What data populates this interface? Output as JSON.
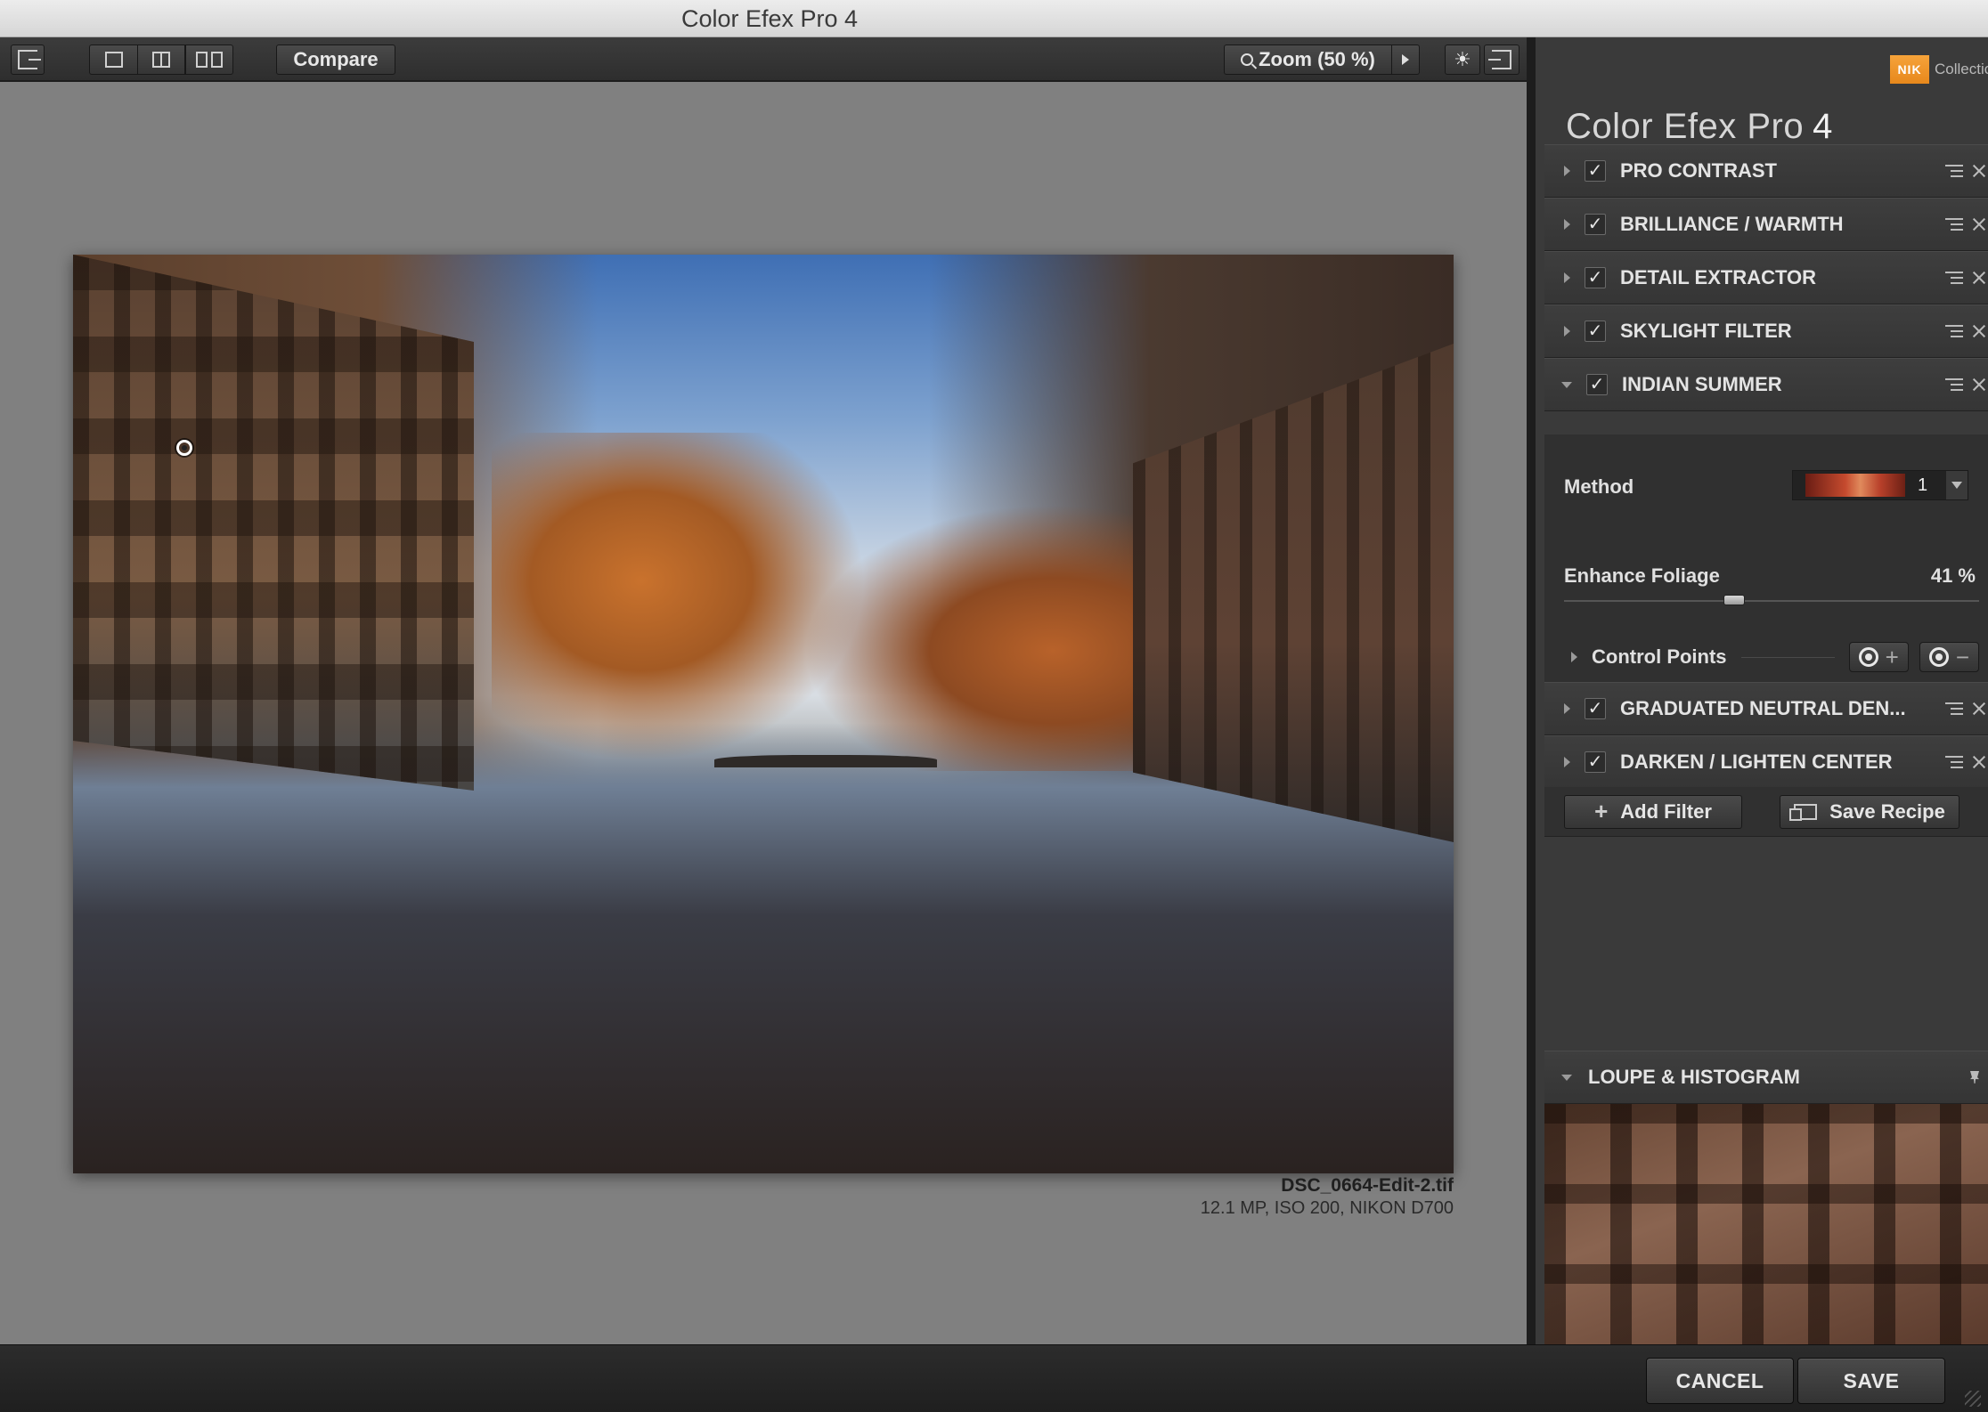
{
  "window": {
    "title": "Color Efex Pro 4"
  },
  "toolbar": {
    "compare_label": "Compare",
    "zoom_label": "Zoom (50 %)"
  },
  "preview": {
    "file_name": "DSC_0664-Edit-2.tif",
    "file_meta": "12.1 MP, ISO 200, NIKON D700"
  },
  "panel": {
    "brand_badge": "NIK",
    "brand_text": "Collection",
    "app_name": "Color Efex Pro",
    "app_version": "4",
    "filters": [
      {
        "name": "PRO CONTRAST",
        "enabled": true,
        "expanded": false
      },
      {
        "name": "BRILLIANCE / WARMTH",
        "enabled": true,
        "expanded": false
      },
      {
        "name": "DETAIL EXTRACTOR",
        "enabled": true,
        "expanded": false
      },
      {
        "name": "SKYLIGHT FILTER",
        "enabled": true,
        "expanded": false
      },
      {
        "name": "INDIAN SUMMER",
        "enabled": true,
        "expanded": true
      },
      {
        "name": "GRADUATED NEUTRAL DEN...",
        "enabled": true,
        "expanded": false
      },
      {
        "name": "DARKEN / LIGHTEN CENTER",
        "enabled": true,
        "expanded": false
      }
    ],
    "indian_summer": {
      "method_label": "Method",
      "method_value": "1",
      "enhance_label": "Enhance Foliage",
      "enhance_value": "41 %",
      "enhance_fraction": 0.41
    },
    "control_points_label": "Control Points",
    "add_filter_label": "Add Filter",
    "save_recipe_label": "Save Recipe",
    "loupe_label": "LOUPE & HISTOGRAM"
  },
  "footer": {
    "cancel_label": "CANCEL",
    "save_label": "SAVE"
  },
  "icons": {
    "exit_left": "exit-left-icon",
    "single_view": "single-view-icon",
    "split_view": "split-view-icon",
    "side_by_side": "side-by-side-icon",
    "search": "search-icon",
    "play": "play-icon",
    "bulb": "bulb-icon",
    "exit_right": "exit-right-icon"
  },
  "colors": {
    "accent_orange": "#f0952a",
    "panel_bg": "#3a3a3a",
    "canvas_bg": "#808080"
  }
}
